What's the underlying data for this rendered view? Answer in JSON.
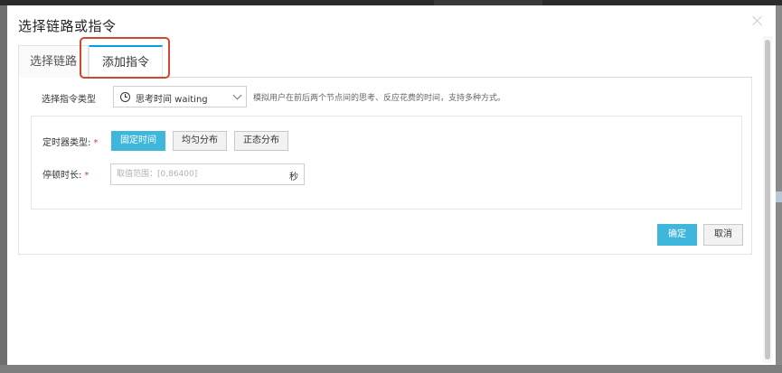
{
  "dialog": {
    "title": "选择链路或指令"
  },
  "tabs": [
    {
      "label": "选择链路",
      "active": false
    },
    {
      "label": "添加指令",
      "active": true
    }
  ],
  "command_type": {
    "label": "选择指令类型",
    "selected": "思考时间 waiting",
    "icon": "clock-icon",
    "hint": "模拟用户在前后两个节点间的思考、反应花费的时间，支持多种方式。"
  },
  "timer_type": {
    "label": "定时器类型:",
    "required_mark": "*",
    "options": [
      {
        "label": "固定时间",
        "active": true
      },
      {
        "label": "均匀分布",
        "active": false
      },
      {
        "label": "正态分布",
        "active": false
      }
    ]
  },
  "pause_duration": {
    "label": "停顿时长:",
    "required_mark": "*",
    "value": "",
    "placeholder": "取值范围：[0,86400]",
    "unit": "秒"
  },
  "actions": {
    "confirm_label": "确定",
    "cancel_label": "取消"
  },
  "colors": {
    "accent": "#3fb6dc",
    "highlight": "#d0462e",
    "required": "#e0393e",
    "active_tab_border": "#00a0e9"
  }
}
